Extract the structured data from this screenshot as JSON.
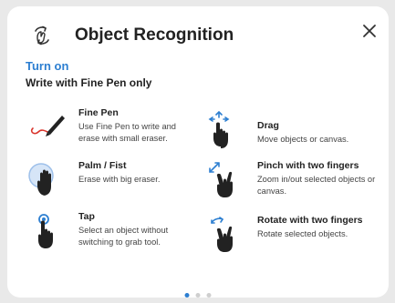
{
  "header": {
    "title": "Object Recognition",
    "icon": "object-recognition-icon",
    "close_icon": "close-icon"
  },
  "toggle": {
    "label": "Turn on"
  },
  "subtitle": "Write with Fine Pen only",
  "items_left": [
    {
      "icon": "fine-pen-icon",
      "title": "Fine Pen",
      "desc": "Use Fine Pen to write and erase with small eraser."
    },
    {
      "icon": "palm-icon",
      "title": "Palm / Fist",
      "desc": "Erase with big eraser."
    },
    {
      "icon": "tap-icon",
      "title": "Tap",
      "desc": "Select an object without switching to grab tool."
    }
  ],
  "items_right": [
    {
      "icon": "drag-icon",
      "title": "Drag",
      "desc": "Move objects or canvas."
    },
    {
      "icon": "pinch-icon",
      "title": "Pinch with two fingers",
      "desc": "Zoom in/out selected objects or canvas."
    },
    {
      "icon": "rotate-icon",
      "title": "Rotate with two fingers",
      "desc": "Rotate selected objects."
    }
  ],
  "pagination": {
    "pages": 3,
    "active_page": 1
  },
  "colors": {
    "accent": "#2d7fd1",
    "text": "#222222",
    "pen_line": "#d9342b"
  }
}
